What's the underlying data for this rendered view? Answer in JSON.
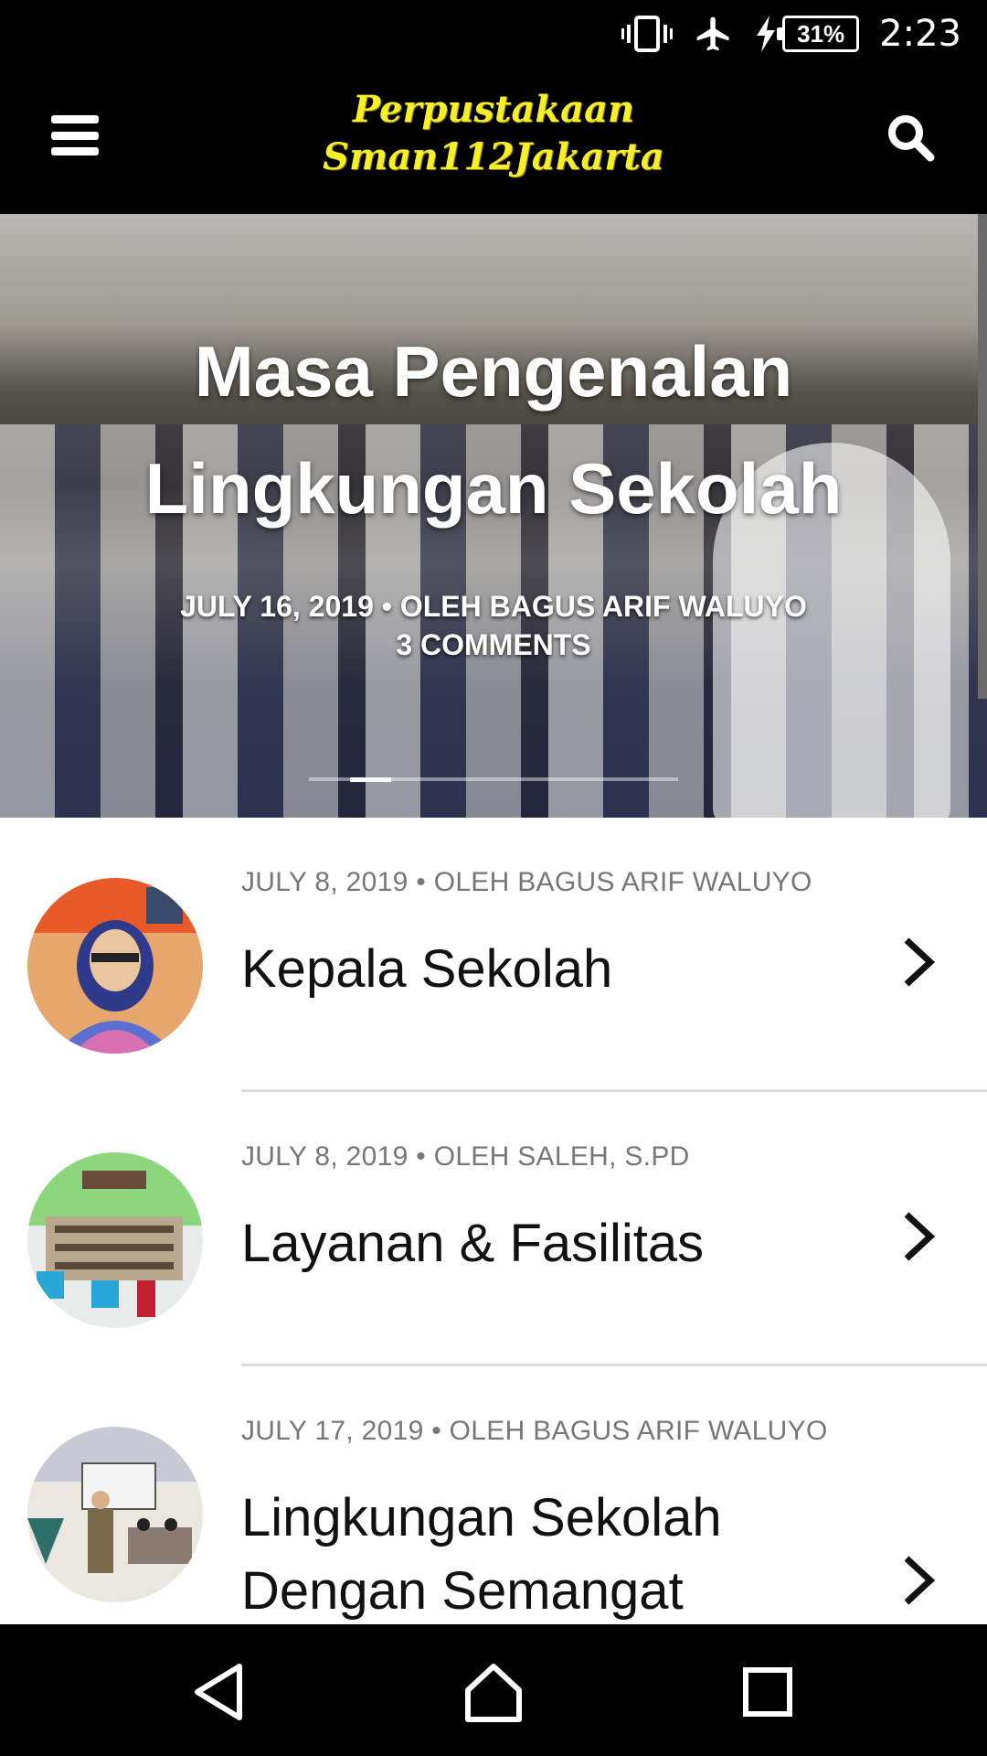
{
  "status_bar": {
    "time": "2:23",
    "battery": "31%",
    "icons": [
      "vibrate-icon",
      "airplane-icon",
      "charging-icon",
      "battery-icon"
    ]
  },
  "app_bar": {
    "logo_line1": "Perpustakaan",
    "logo_line2": "Sman112Jakarta",
    "logo_color": "#f5ef2a",
    "menu_icon": "hamburger-icon",
    "search_icon": "search-icon"
  },
  "hero": {
    "title": "Masa Pengenalan Lingkungan Sekolah",
    "meta_line1": "JULY 16, 2019 • OLEH BAGUS ARIF WALUYO",
    "meta_line2": "3 COMMENTS",
    "pager": {
      "pages": 9,
      "active_index": 1
    }
  },
  "posts": [
    {
      "meta": "JULY 8, 2019 • OLEH BAGUS ARIF WALUYO",
      "title": "Kepala Sekolah",
      "thumb": "principal-photo"
    },
    {
      "meta": "JULY 8, 2019 • OLEH SALEH, S.PD",
      "title": "Layanan & Fasilitas",
      "thumb": "library-room-photo"
    },
    {
      "meta": "JULY 17, 2019 • OLEH BAGUS ARIF WALUYO",
      "title": "Lingkungan Sekolah Dengan Semangat",
      "thumb": "classroom-photo"
    }
  ],
  "nav_bar": {
    "back_icon": "back-icon",
    "home_icon": "home-icon",
    "recents_icon": "recents-icon"
  }
}
